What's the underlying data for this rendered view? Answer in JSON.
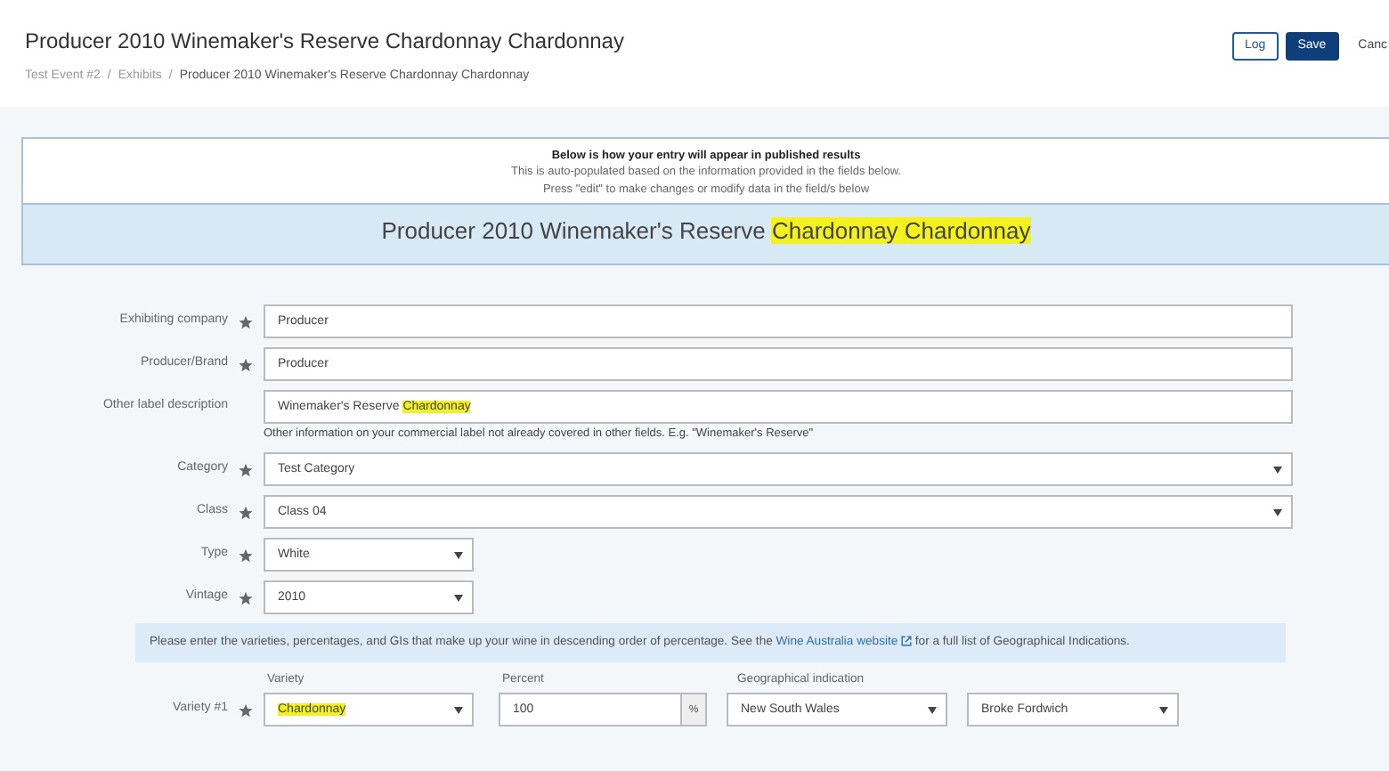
{
  "header": {
    "title": "Producer 2010 Winemaker's Reserve Chardonnay Chardonnay",
    "breadcrumbs": [
      {
        "text": "Test Event #2",
        "current": false
      },
      {
        "text": "Exhibits",
        "current": false
      },
      {
        "text": "Producer 2010 Winemaker's Reserve Chardonnay Chardonnay",
        "current": true
      }
    ],
    "separator": "/",
    "buttons": [
      {
        "label": "Log",
        "kind": "outline"
      },
      {
        "label": "Save",
        "kind": "primary"
      },
      {
        "label": "Canc",
        "kind": "link"
      }
    ]
  },
  "preview": {
    "heading": "Below is how your entry will appear in published results",
    "notes": [
      "This is auto-populated based on the information provided in the fields below.",
      "Press \"edit\" to make changes or modify data in the field/s below"
    ],
    "title": [
      {
        "text": "Producer 2010 Winemaker's Reserve ",
        "highlighted": false
      },
      {
        "text": "Chardonnay Chardonnay",
        "highlighted": true
      }
    ]
  },
  "fields": [
    {
      "label": "Exhibiting company",
      "required": true,
      "kind": "text",
      "value": [
        {
          "text": "Producer",
          "highlighted": false
        }
      ]
    },
    {
      "label": "Producer/Brand",
      "required": true,
      "kind": "text",
      "value": [
        {
          "text": "Producer",
          "highlighted": false
        }
      ]
    },
    {
      "label": "Other label description",
      "required": false,
      "kind": "text",
      "value": [
        {
          "text": "Winemaker's Reserve ",
          "highlighted": false
        },
        {
          "text": "Chardonnay",
          "highlighted": true
        }
      ],
      "help": "Other information on your commercial label not already covered in other fields. E.g. \"Winemaker's Reserve\""
    },
    {
      "label": "Category",
      "required": true,
      "kind": "select",
      "value": [
        {
          "text": "Test Category",
          "highlighted": false
        }
      ]
    },
    {
      "label": "Class",
      "required": true,
      "kind": "select",
      "value": [
        {
          "text": "Class 04",
          "highlighted": false
        }
      ]
    },
    {
      "label": "Type",
      "required": true,
      "kind": "short_select",
      "value": [
        {
          "text": "White",
          "highlighted": false
        }
      ]
    },
    {
      "label": "Vintage",
      "required": true,
      "kind": "short_select",
      "value": [
        {
          "text": "2010",
          "highlighted": false
        }
      ]
    }
  ],
  "info": {
    "before": "Please enter the varieties, percentages, and GIs that make up your wine in descending order of percentage. See the ",
    "link": "Wine Australia website",
    "after": " for a full list of Geographical Indications."
  },
  "variety_columns": [
    "Variety",
    "Percent",
    "Geographical indication"
  ],
  "varieties": [
    {
      "label": "Variety #1",
      "required": true,
      "variety": [
        {
          "text": "Chardonnay",
          "highlighted": true
        }
      ],
      "percent": "100",
      "percent_unit": "%",
      "gi": "New South Wales",
      "region": "Broke Fordwich"
    }
  ]
}
